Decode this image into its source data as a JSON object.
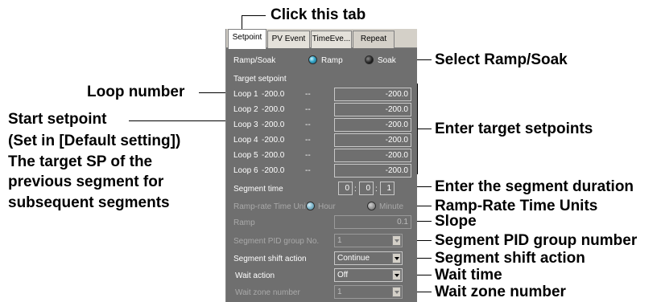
{
  "callouts": {
    "click_tab": "Click this tab",
    "select_ramp_soak": "Select Ramp/Soak",
    "loop_number": "Loop number",
    "start_setpoint_l1": "Start setpoint",
    "start_setpoint_l2": "(Set in [Default setting])",
    "start_setpoint_l3": "The target SP of the",
    "start_setpoint_l4": "previous segment for",
    "start_setpoint_l5": "subsequent segments",
    "enter_target": "Enter target setpoints",
    "enter_duration": "Enter the segment duration",
    "ramp_rate_units": "Ramp-Rate Time Units",
    "slope": "Slope",
    "pid_group": "Segment PID group number",
    "shift_action": "Segment shift action",
    "wait_time": "Wait time",
    "wait_zone": "Wait zone number"
  },
  "tabs": [
    {
      "label": "Setpoint",
      "active": true
    },
    {
      "label": "PV Event",
      "active": false
    },
    {
      "label": "TimeEve...",
      "active": false
    },
    {
      "label": "Repeat",
      "active": false
    }
  ],
  "ramp_soak": {
    "label": "Ramp/Soak",
    "option_ramp": "Ramp",
    "option_soak": "Soak",
    "selected": "Ramp"
  },
  "target_setpoint_label": "Target setpoint",
  "loops": [
    {
      "name": "Loop 1",
      "start": "-200.0",
      "dash": "--",
      "target": "-200.0"
    },
    {
      "name": "Loop 2",
      "start": "-200.0",
      "dash": "--",
      "target": "-200.0"
    },
    {
      "name": "Loop 3",
      "start": "-200.0",
      "dash": "--",
      "target": "-200.0"
    },
    {
      "name": "Loop 4",
      "start": "-200.0",
      "dash": "--",
      "target": "-200.0"
    },
    {
      "name": "Loop 5",
      "start": "-200.0",
      "dash": "--",
      "target": "-200.0"
    },
    {
      "name": "Loop 6",
      "start": "-200.0",
      "dash": "--",
      "target": "-200.0"
    }
  ],
  "segment_time": {
    "label": "Segment time",
    "hours": "0",
    "minutes": "0",
    "seconds": "1",
    "sep": ":"
  },
  "ramp_rate": {
    "label": "Ramp-rate Time Unit",
    "option_hour": "Hour",
    "option_minute": "Minute"
  },
  "ramp": {
    "label": "Ramp",
    "value": "0.1"
  },
  "pid_group": {
    "label": "Segment PID group No.",
    "value": "1"
  },
  "shift_action": {
    "label": "Segment shift action",
    "value": "Continue"
  },
  "wait_action": {
    "label": "Wait action",
    "value": "Off"
  },
  "wait_zone": {
    "label": "Wait zone number",
    "value": "1"
  },
  "colors": {
    "panel_bg": "#6f6f6f",
    "tab_bg": "#d4d0c8",
    "radio_on": "#37a6c9"
  }
}
